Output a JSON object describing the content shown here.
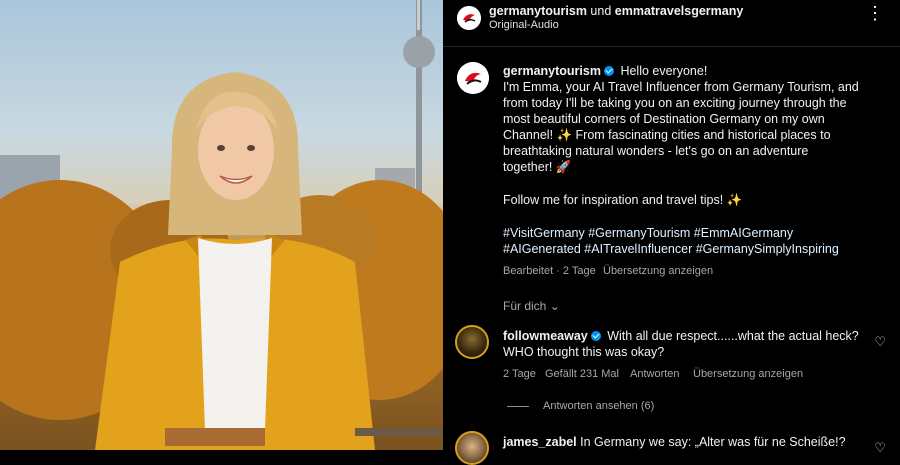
{
  "header": {
    "account1": "germanytourism",
    "connector": " und ",
    "account2": "emmatravelsgermany",
    "audio": "Original-Audio"
  },
  "caption": {
    "username": "germanytourism",
    "greeting": "Hello everyone!",
    "lines": [
      "I'm Emma, your AI Travel Influencer from Germany Tourism, and",
      "from today I'll be taking you on an exciting journey through the",
      "most beautiful corners of Destination Germany on my own",
      "Channel! ✨ From fascinating cities and historical places to",
      "breathtaking natural wonders - let's go on an adventure",
      "together! 🚀"
    ],
    "follow_line": "Follow me for inspiration and travel tips! ✨",
    "hashtags": [
      "#VisitGermany #GermanyTourism #EmmAIGermany",
      "#AIGenerated #AITravelInfluencer #GermanySimplyInspiring"
    ],
    "meta": "Bearbeitet · 2 Tage",
    "translate": "Übersetzung anzeigen"
  },
  "sort_label": "Für dich",
  "comments": [
    {
      "username": "followmeaway",
      "line1": "With all due respect......what the actual heck?",
      "line2": "WHO thought this was okay?",
      "age": "2 Tage",
      "likes": "Gefällt 231 Mal",
      "reply": "Antworten",
      "translate": "Übersetzung anzeigen",
      "view_replies": "Antworten ansehen (6)"
    },
    {
      "username": "james_zabel",
      "line1": "In Germany we say: „Alter was für ne Scheiße!?"
    }
  ],
  "icons": {
    "more": "⋮",
    "heart": "♡",
    "chevron": "⌄"
  },
  "colors": {
    "verified": "#0095f6",
    "coat": "#e3a21b"
  }
}
